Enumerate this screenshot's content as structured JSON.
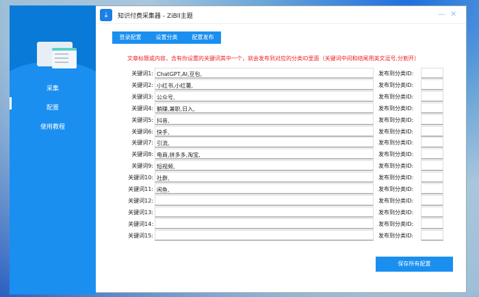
{
  "window": {
    "title": "知识付费采集器 - ZiBll主题"
  },
  "sidebar": {
    "items": [
      {
        "label": "采集"
      },
      {
        "label": "配置",
        "active": true
      },
      {
        "label": "使用教程"
      }
    ]
  },
  "tabs": [
    {
      "label": "登录配置"
    },
    {
      "label": "设置分类",
      "active": true
    },
    {
      "label": "配置发布"
    }
  ],
  "hint": "文章标题或内容，含有你设置的关键词其中一个，就会发布到对应的分类ID里面（关键词中间和结尾用英文逗号,分割开）",
  "rows": [
    {
      "label": "关键词1:",
      "value": "ChatGPT,AI,豆包,",
      "id_label": "发布到分类ID:",
      "id": ""
    },
    {
      "label": "关键词2:",
      "value": "小红书,小红薯,",
      "id_label": "发布到分类ID:",
      "id": ""
    },
    {
      "label": "关键词3:",
      "value": "公众号,",
      "id_label": "发布到分类ID:",
      "id": ""
    },
    {
      "label": "关键词4:",
      "value": "躺赚,兼职,日入,",
      "id_label": "发布到分类ID:",
      "id": ""
    },
    {
      "label": "关键词5:",
      "value": "抖音,",
      "id_label": "发布到分类ID:",
      "id": ""
    },
    {
      "label": "关键词6:",
      "value": "快手,",
      "id_label": "发布到分类ID:",
      "id": ""
    },
    {
      "label": "关键词7:",
      "value": "引流,",
      "id_label": "发布到分类ID:",
      "id": ""
    },
    {
      "label": "关键词8:",
      "value": "电商,拼多多,淘宝,",
      "id_label": "发布到分类ID:",
      "id": ""
    },
    {
      "label": "关键词9:",
      "value": "短视频,",
      "id_label": "发布到分类ID:",
      "id": ""
    },
    {
      "label": "关键词10:",
      "value": "社群,",
      "id_label": "发布到分类ID:",
      "id": ""
    },
    {
      "label": "关键词11:",
      "value": "闲鱼,",
      "id_label": "发布到分类ID:",
      "id": ""
    },
    {
      "label": "关键词12:",
      "value": "",
      "id_label": "发布到分类ID:",
      "id": ""
    },
    {
      "label": "关键词13:",
      "value": "",
      "id_label": "发布到分类ID:",
      "id": ""
    },
    {
      "label": "关键词14:",
      "value": "",
      "id_label": "发布到分类ID:",
      "id": ""
    },
    {
      "label": "关键词15:",
      "value": "",
      "id_label": "发布到分类ID:",
      "id": ""
    }
  ],
  "save_label": "保存所有配置",
  "colors": {
    "accent": "#1a8ff0",
    "hint": "#f02020"
  }
}
